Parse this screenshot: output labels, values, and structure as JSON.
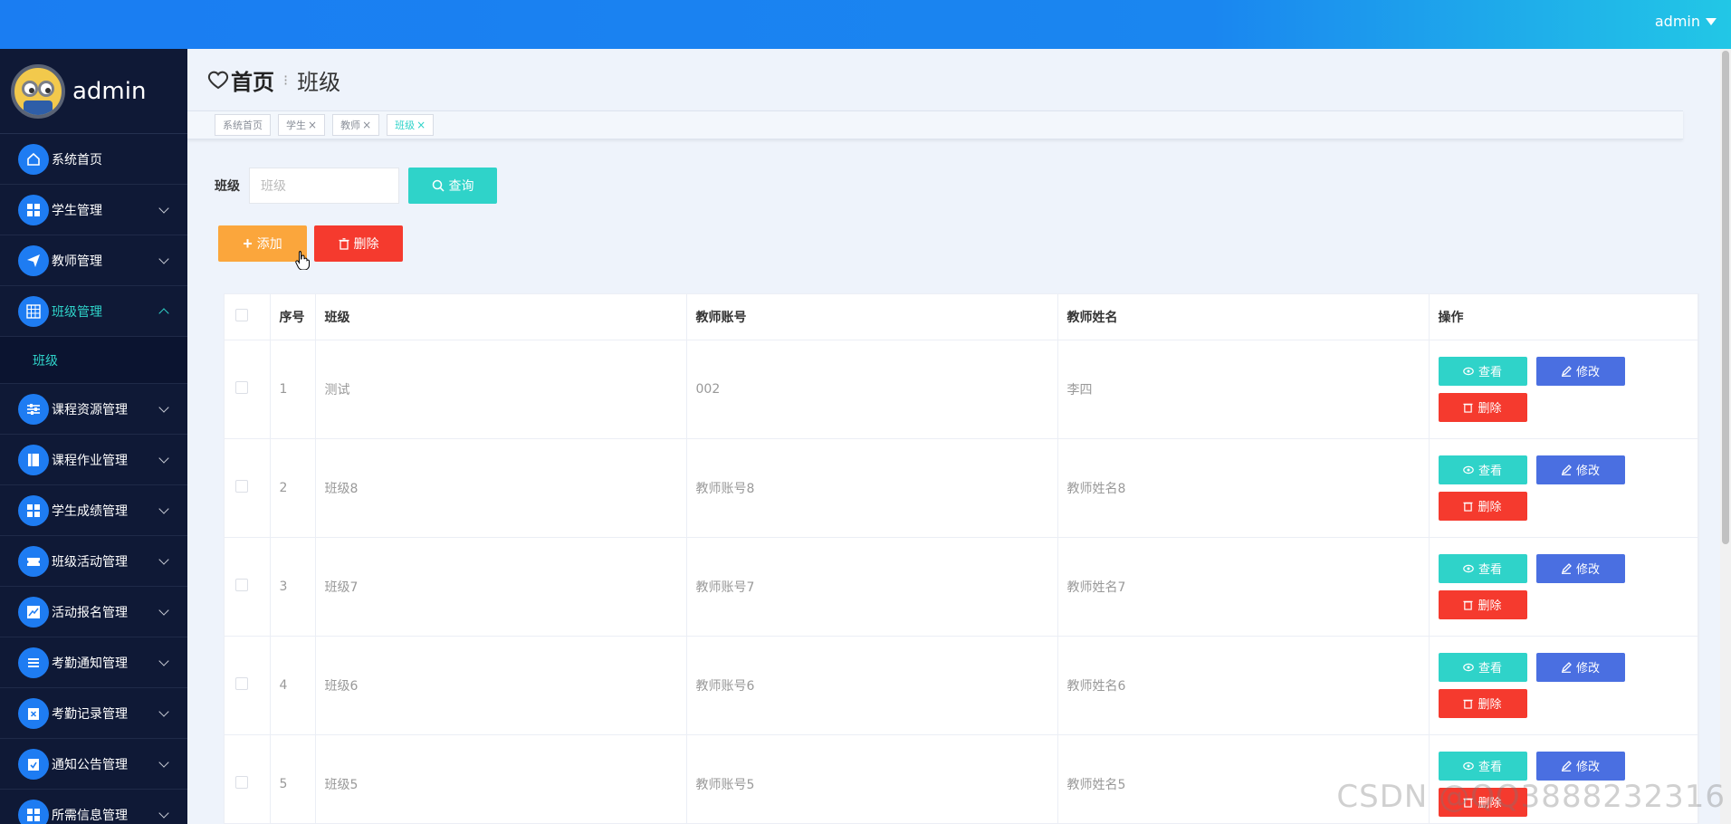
{
  "header": {
    "user": "admin"
  },
  "sidebar": {
    "profile_name": "admin",
    "items": [
      {
        "label": "系统首页",
        "icon": "home-icon"
      },
      {
        "label": "学生管理",
        "icon": "grid-icon"
      },
      {
        "label": "教师管理",
        "icon": "send-icon"
      },
      {
        "label": "班级管理",
        "icon": "table-icon",
        "expanded": true,
        "sub": "班级"
      },
      {
        "label": "课程资源管理",
        "icon": "sliders-icon"
      },
      {
        "label": "课程作业管理",
        "icon": "book-icon"
      },
      {
        "label": "学生成绩管理",
        "icon": "grid-icon"
      },
      {
        "label": "班级活动管理",
        "icon": "ticket-icon"
      },
      {
        "label": "活动报名管理",
        "icon": "chart-icon"
      },
      {
        "label": "考勤通知管理",
        "icon": "list-icon"
      },
      {
        "label": "考勤记录管理",
        "icon": "clipboard-x-icon"
      },
      {
        "label": "通知公告管理",
        "icon": "clipboard-check-icon"
      },
      {
        "label": "所需信息管理",
        "icon": "grid-icon"
      }
    ]
  },
  "breadcrumb": {
    "home": "首页",
    "current": "班级"
  },
  "tags": [
    {
      "label": "系统首页",
      "closable": false
    },
    {
      "label": "学生",
      "closable": true
    },
    {
      "label": "教师",
      "closable": true
    },
    {
      "label": "班级",
      "closable": true,
      "active": true
    }
  ],
  "search": {
    "label": "班级",
    "placeholder": "班级",
    "button": "查询"
  },
  "actions": {
    "add": "添加",
    "delete": "删除"
  },
  "table": {
    "headers": [
      "序号",
      "班级",
      "教师账号",
      "教师姓名",
      "操作"
    ],
    "rows": [
      {
        "idx": "1",
        "cls": "测试",
        "acc": "002",
        "name": "李四"
      },
      {
        "idx": "2",
        "cls": "班级8",
        "acc": "教师账号8",
        "name": "教师姓名8"
      },
      {
        "idx": "3",
        "cls": "班级7",
        "acc": "教师账号7",
        "name": "教师姓名7"
      },
      {
        "idx": "4",
        "cls": "班级6",
        "acc": "教师账号6",
        "name": "教师姓名6"
      },
      {
        "idx": "5",
        "cls": "班级5",
        "acc": "教师账号5",
        "name": "教师姓名5"
      }
    ],
    "ops": {
      "view": "查看",
      "edit": "修改",
      "del": "删除"
    }
  },
  "watermark": "CSDN @QQ3888232316",
  "colors": {
    "accent": "#2fd3c9",
    "primary": "#1a7df2",
    "danger": "#f53a2e",
    "warning": "#fba63c",
    "edit": "#4a6fe1",
    "sidebar": "#0f1936"
  }
}
